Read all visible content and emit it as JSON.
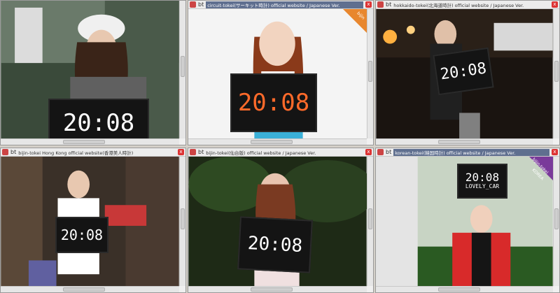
{
  "windows": [
    {
      "title": "",
      "bt": "bt",
      "time": "20:08",
      "badge": ""
    },
    {
      "title": "circuit-tokei(サーキット時計) official website / Japanese Ver.",
      "bt": "bt",
      "time": "20:08",
      "badge": "bijin"
    },
    {
      "title": "hokkaido-tokei(北海道時計) official website / Japanese Ver.",
      "bt": "bt",
      "time": "20:08",
      "badge": ""
    },
    {
      "title": "bijin-tokei Hong Kong official website(香港美人時計)",
      "bt": "bt",
      "time": "20:08",
      "badge": ""
    },
    {
      "title": "bijin-tokei(仙台版) official website / Japanese Ver.",
      "bt": "bt",
      "time": "20:08",
      "badge": ""
    },
    {
      "title": "korean-tokei(韓国時計) official website / Japanese Ver.",
      "bt": "bt",
      "time": "20:08",
      "badge": "bijin-tokei",
      "extra": "KOREA",
      "board_line2": "LOVELY_CAR"
    }
  ],
  "close_glyph": "x"
}
